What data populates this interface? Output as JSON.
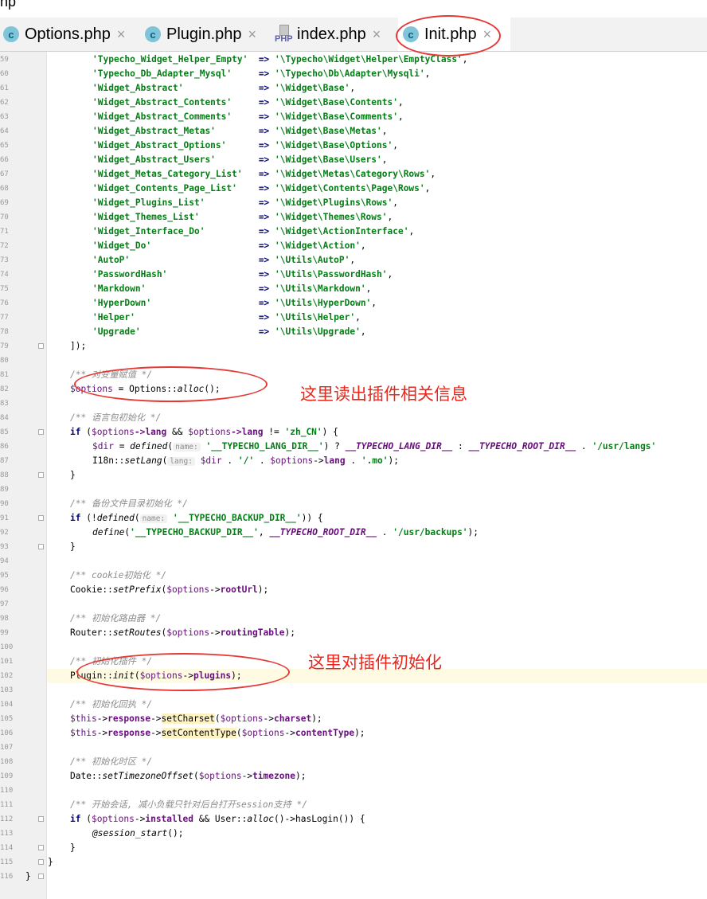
{
  "window": {
    "title_fragment": "hp"
  },
  "tabs": [
    {
      "label": "Options.php",
      "icon": "c-class-icon",
      "active": false
    },
    {
      "label": "Plugin.php",
      "icon": "c-class-icon",
      "active": false
    },
    {
      "label": "index.php",
      "icon": "php-file-icon",
      "active": false
    },
    {
      "label": "Init.php",
      "icon": "c-class-icon",
      "active": true
    }
  ],
  "tab_icon_text": {
    "class": "c",
    "php": "PHP",
    "close": "×"
  },
  "hints": {
    "name": "name:",
    "lang": "lang:"
  },
  "annotations": {
    "read_plugin_info": "这里读出插件相关信息",
    "init_plugin": "这里对插件初始化"
  },
  "annotation_color": "#e53935",
  "line_numbers": [
    "59",
    "60",
    "61",
    "62",
    "63",
    "64",
    "65",
    "66",
    "67",
    "68",
    "69",
    "70",
    "71",
    "72",
    "73",
    "74",
    "75",
    "76",
    "77",
    "78",
    "79",
    "80",
    "81",
    "82",
    "83",
    "84",
    "85",
    "86",
    "87",
    "88",
    "89",
    "90",
    "91",
    "92",
    "93",
    "94",
    "95",
    "96",
    "97",
    "98",
    "99",
    "100",
    "101",
    "102",
    "103",
    "104",
    "105",
    "106",
    "107",
    "108",
    "109",
    "110",
    "111",
    "112",
    "113",
    "114",
    "115",
    "116"
  ],
  "class_map": [
    [
      "'Typecho_Widget_Helper_Empty'",
      "'\\Typecho\\Widget\\Helper\\EmptyClass'"
    ],
    [
      "'Typecho_Db_Adapter_Mysql'",
      "'\\Typecho\\Db\\Adapter\\Mysqli'"
    ],
    [
      "'Widget_Abstract'",
      "'\\Widget\\Base'"
    ],
    [
      "'Widget_Abstract_Contents'",
      "'\\Widget\\Base\\Contents'"
    ],
    [
      "'Widget_Abstract_Comments'",
      "'\\Widget\\Base\\Comments'"
    ],
    [
      "'Widget_Abstract_Metas'",
      "'\\Widget\\Base\\Metas'"
    ],
    [
      "'Widget_Abstract_Options'",
      "'\\Widget\\Base\\Options'"
    ],
    [
      "'Widget_Abstract_Users'",
      "'\\Widget\\Base\\Users'"
    ],
    [
      "'Widget_Metas_Category_List'",
      "'\\Widget\\Metas\\Category\\Rows'"
    ],
    [
      "'Widget_Contents_Page_List'",
      "'\\Widget\\Contents\\Page\\Rows'"
    ],
    [
      "'Widget_Plugins_List'",
      "'\\Widget\\Plugins\\Rows'"
    ],
    [
      "'Widget_Themes_List'",
      "'\\Widget\\Themes\\Rows'"
    ],
    [
      "'Widget_Interface_Do'",
      "'\\Widget\\ActionInterface'"
    ],
    [
      "'Widget_Do'",
      "'\\Widget\\Action'"
    ],
    [
      "'AutoP'",
      "'\\Utils\\AutoP'"
    ],
    [
      "'PasswordHash'",
      "'\\Utils\\PasswordHash'"
    ],
    [
      "'Markdown'",
      "'\\Utils\\Markdown'"
    ],
    [
      "'HyperDown'",
      "'\\Utils\\HyperDown'"
    ],
    [
      "'Helper'",
      "'\\Utils\\Helper'"
    ],
    [
      "'Upgrade'",
      "'\\Utils\\Upgrade'"
    ]
  ],
  "code": {
    "arrow": "=>",
    "comma": ",",
    "close_array": "]);",
    "c_assign": "/** 对变量赋值 */",
    "options_var": "$options",
    "assign_rest": " = Options::",
    "alloc": "alloc",
    "call_end": "();",
    "c_lang": "/** 语言包初始化 */",
    "if_kw": "if",
    "lang_cond_a": " (",
    "lang_arrow_lang": "->lang",
    "lang_and": " && ",
    "lang_ne": " != ",
    "zh_cn": "'zh_CN'",
    "paren_brace": ") {",
    "dir_var": "$dir",
    "eq": " = ",
    "defined_fn": "defined",
    "open_paren": "(",
    "lang_dir_str": "'__TYPECHO_LANG_DIR__'",
    "ternary_q": ") ? ",
    "lang_dir_const": "__TYPECHO_LANG_DIR__",
    "ternary_c": " : ",
    "root_dir_const": "__TYPECHO_ROOT_DIR__",
    "concat": " . ",
    "usr_langs": "'/usr/langs'",
    "i18n": "I18n::",
    "setlang_fn": "setLang",
    "slash": "'/'",
    "lang_prop": "lang",
    "mo": "'.mo'",
    "close_stmt": ");",
    "close_brace": "}",
    "c_backup": "/** 备份文件目录初始化 */",
    "if_not": " (!",
    "backup_str": "'__TYPECHO_BACKUP_DIR__'",
    "paren_close_brace": ")) {",
    "define_fn": "define",
    "comma_sp": ", ",
    "usr_backups": "'/usr/backups'",
    "c_cookie": "/** cookie初始化 */",
    "cookie_cls": "Cookie::",
    "setprefix_fn": "setPrefix",
    "arrow_op": "->",
    "rooturl": "rootUrl",
    "c_router": "/** 初始化路由器 */",
    "router_cls": "Router::",
    "setroutes_fn": "setRoutes",
    "routingtable": "routingTable",
    "c_plugin": "/** 初始化插件 */",
    "plugin_cls": "Plugin::",
    "init_fn": "init",
    "plugins_prop": "plugins",
    "c_response": "/** 初始化回执 */",
    "this_var": "$this",
    "response_prop": "response",
    "setcharset_fn": "setCharset",
    "charset_prop": "charset",
    "setcontenttype_fn": "setContentType",
    "contenttype_prop": "contentType",
    "c_tz": "/** 初始化时区 */",
    "date_cls": "Date::",
    "settz_fn": "setTimezoneOffset",
    "timezone_prop": "timezone",
    "c_session": "/** 开始会话, 减小负载只针对后台打开session支持 */",
    "installed_prop": "installed",
    "user_cls": "User::",
    "haslogin": "hasLogin",
    "close_cond": "()) {",
    "at_session": "@session_start",
    "arrow_alloc": "()->"
  }
}
